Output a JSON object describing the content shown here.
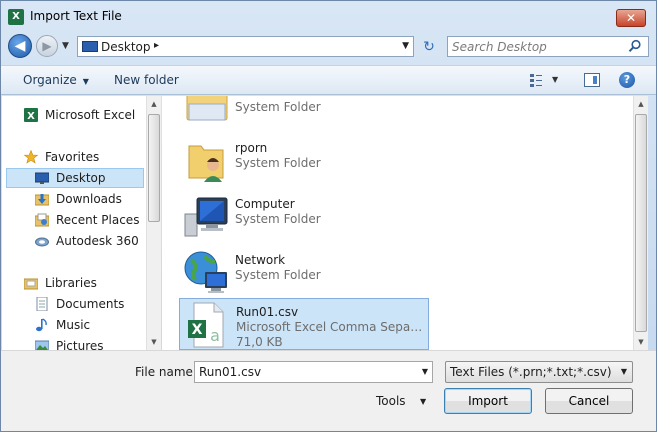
{
  "window": {
    "title": "Import Text File",
    "app_icon": "excel-icon"
  },
  "titlebar": {
    "close_glyph": "✕"
  },
  "addressbar": {
    "location": "Desktop",
    "separator": "▸",
    "dropdown_glyph": "▼",
    "back_glyph": "◀",
    "forward_glyph": "▶",
    "refresh_glyph": "↻"
  },
  "search": {
    "placeholder": "Search Desktop"
  },
  "toolbar": {
    "organize_label": "Organize",
    "new_folder_label": "New folder",
    "caret": "▼",
    "help_glyph": "?"
  },
  "navigation": {
    "items": [
      {
        "label": "Microsoft Excel",
        "icon": "excel-icon"
      },
      {
        "label": "Favorites",
        "icon": "star-icon"
      },
      {
        "label": "Desktop",
        "icon": "desktop-icon",
        "selected": true
      },
      {
        "label": "Downloads",
        "icon": "downloads-icon"
      },
      {
        "label": "Recent Places",
        "icon": "recent-places-icon"
      },
      {
        "label": "Autodesk 360",
        "icon": "cloud-icon"
      },
      {
        "label": "Libraries",
        "icon": "libraries-icon"
      },
      {
        "label": "Documents",
        "icon": "documents-icon"
      },
      {
        "label": "Music",
        "icon": "music-icon"
      },
      {
        "label": "Pictures",
        "icon": "pictures-icon"
      }
    ]
  },
  "files": [
    {
      "name": "",
      "type": "System Folder",
      "icon": "folder-icon"
    },
    {
      "name": "rporn",
      "type": "System Folder",
      "icon": "user-folder-icon"
    },
    {
      "name": "Computer",
      "type": "System Folder",
      "icon": "computer-icon"
    },
    {
      "name": "Network",
      "type": "System Folder",
      "icon": "network-icon"
    },
    {
      "name": "Run01.csv",
      "type": "Microsoft Excel Comma Separate...",
      "size": "71,0 KB",
      "icon": "excel-csv-icon",
      "selected": true
    }
  ],
  "bottom": {
    "file_name_label": "File name:",
    "file_name_value": "Run01.csv",
    "file_type_value": "Text Files (*.prn;*.txt;*.csv)",
    "tools_label": "Tools",
    "import_label": "Import",
    "cancel_label": "Cancel"
  }
}
